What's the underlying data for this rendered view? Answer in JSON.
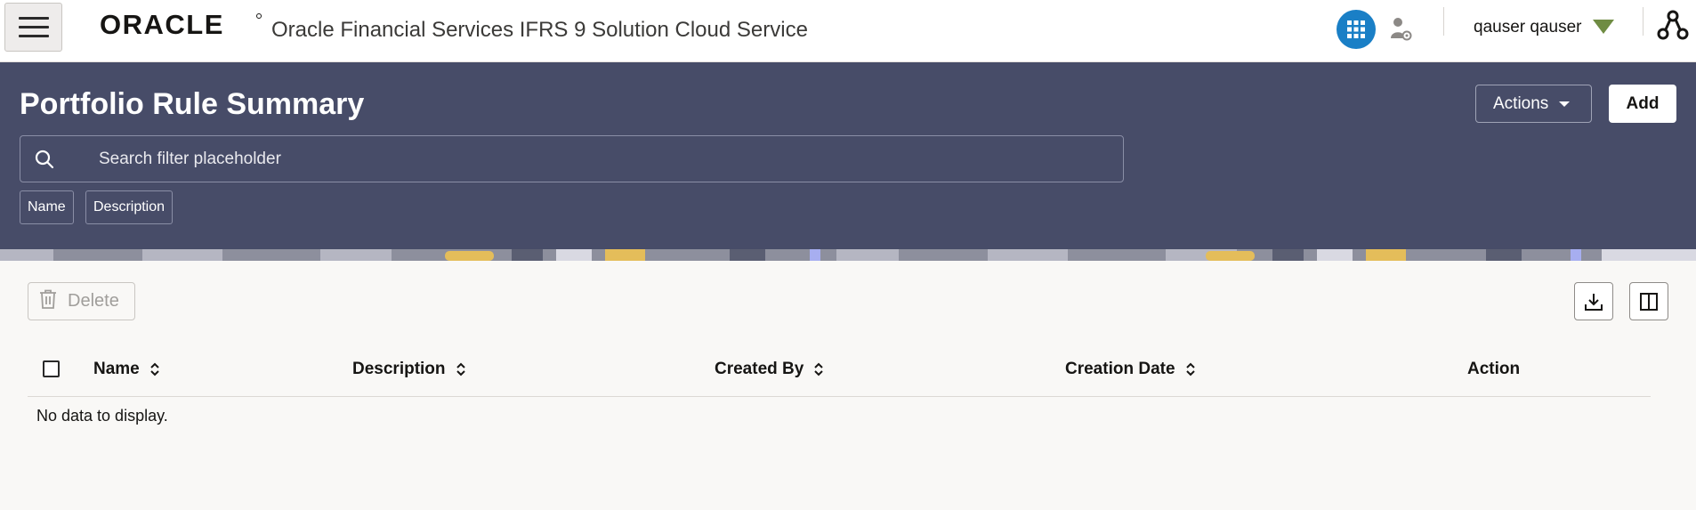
{
  "header": {
    "brand": "ORACLE",
    "app_title": "Oracle Financial Services IFRS 9 Solution Cloud Service",
    "username": "qauser qauser",
    "icons": [
      "hamburger-menu-icon",
      "apps-grid-icon",
      "user-gear-icon",
      "user-menu-caret-icon",
      "network-icon"
    ],
    "colors": {
      "apps_button": "#1a7fc6",
      "user_caret": "#6f8c43"
    }
  },
  "banner": {
    "title": "Portfolio Rule Summary",
    "actions_label": "Actions",
    "add_label": "Add",
    "search_placeholder": "Search filter placeholder",
    "filter_chips": [
      "Name",
      "Description"
    ],
    "colors": {
      "background": "#474c68"
    }
  },
  "toolbar": {
    "delete_label": "Delete",
    "icons": [
      "trash-icon",
      "download-icon",
      "columns-icon"
    ]
  },
  "table": {
    "columns": [
      "Name",
      "Description",
      "Created By",
      "Creation Date",
      "Action"
    ],
    "empty_text": "No data to display."
  }
}
